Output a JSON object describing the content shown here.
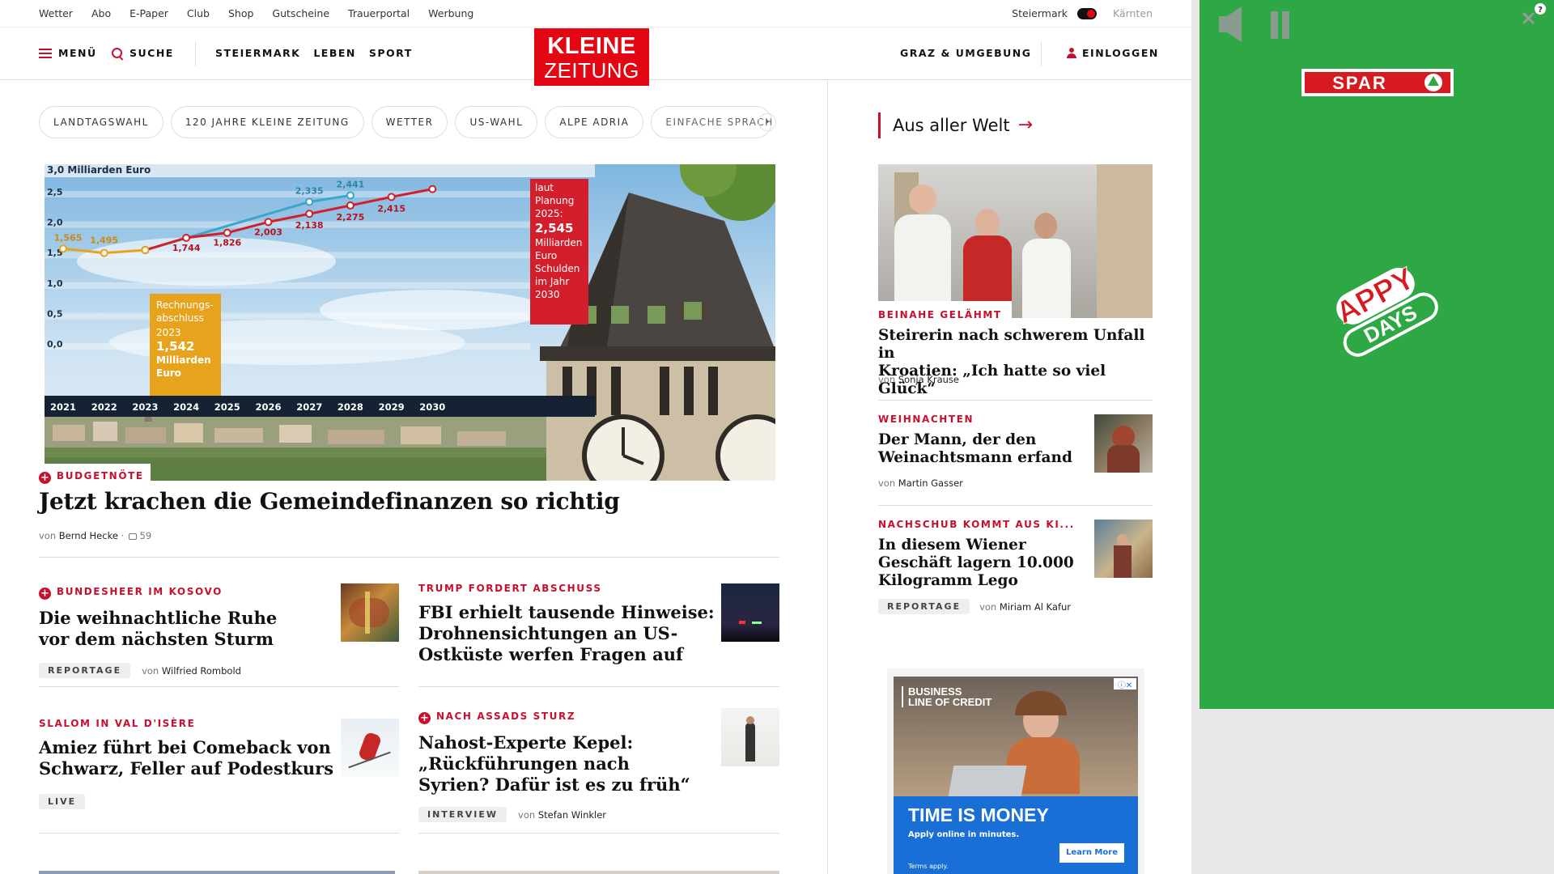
{
  "util_nav": {
    "links": [
      "Wetter",
      "Abo",
      "E-Paper",
      "Club",
      "Shop",
      "Gutscheine",
      "Trauerportal",
      "Werbung"
    ],
    "region_left": "Steiermark",
    "region_right": "Kärnten"
  },
  "header": {
    "menu": "MENÜ",
    "search": "SUCHE",
    "nav": [
      "STEIERMARK",
      "LEBEN",
      "SPORT"
    ],
    "logo_line1": "KLEINE",
    "logo_line2": "ZEITUNG",
    "region_link": "GRAZ & UMGEBUNG",
    "login": "EINLOGGEN"
  },
  "chips": [
    "LANDTAGSWAHL",
    "120 JAHRE KLEINE ZEITUNG",
    "WETTER",
    "US-WAHL",
    "ALPE ADRIA",
    "EINFACHE SPRACHE"
  ],
  "hero": {
    "chart": {
      "unit_label": "3,0 Milliarden Euro",
      "y_ticks": [
        "3,0",
        "2,5",
        "2,0",
        "1,5",
        "1,0",
        "0,5",
        "0,0"
      ],
      "x_ticks": [
        "2021",
        "2022",
        "2023",
        "2024",
        "2025",
        "2026",
        "2027",
        "2028",
        "2029",
        "2030"
      ],
      "series_blue_labels": [
        "2,335",
        "2,441"
      ],
      "series_red_labels": [
        "1,744",
        "1,826",
        "2,003",
        "2,138",
        "2,275",
        "2,415"
      ],
      "series_yellow_labels": [
        "1,565",
        "1,495"
      ],
      "box_yellow": [
        "Rechnungs-",
        "abschluss",
        "2023",
        "1,542",
        "Milliarden",
        "Euro"
      ],
      "box_red": [
        "laut",
        "Planung",
        "2025:",
        "2,545",
        "Milliarden",
        "Euro",
        "Schulden",
        "im Jahr",
        "2030"
      ]
    },
    "kicker": "BUDGETNÖTE",
    "title": "Jetzt krachen die Gemeindefinanzen so richtig",
    "by": "von",
    "author": "Bernd Hecke",
    "comments": "59"
  },
  "articles": [
    {
      "kicker": "BUNDESHEER IM KOSOVO",
      "plus": true,
      "title_lines": [
        "Die weihnachtliche Ruhe",
        "vor dem nächsten Sturm"
      ],
      "tag": "REPORTAGE",
      "by": "von",
      "author": "Wilfried Rombold"
    },
    {
      "kicker": "TRUMP FORDERT ABSCHUSS",
      "plus": false,
      "title_lines": [
        "FBI erhielt tausende Hinweise:",
        "Drohnensichtungen an US-",
        "Ostküste werfen Fragen auf"
      ]
    },
    {
      "kicker": "SLALOM IN VAL D'ISÈRE",
      "plus": false,
      "title_lines": [
        "Amiez führt bei Comeback von",
        "Schwarz, Feller auf Podestkurs"
      ],
      "tag": "LIVE"
    },
    {
      "kicker": "NACH ASSADS STURZ",
      "plus": true,
      "title_lines": [
        "Nahost-Experte Kepel:",
        "„Rückführungen nach",
        "Syrien? Dafür ist es zu früh“"
      ],
      "tag": "INTERVIEW",
      "by": "von",
      "author": "Stefan Winkler"
    }
  ],
  "sidebar": {
    "section": "Aus aller Welt",
    "lead": {
      "kicker": "BEINAHE GELÄHMT",
      "title_lines": [
        "Steirerin nach schwerem Unfall in",
        "Kroatien: „Ich hatte so viel Glück“"
      ],
      "by": "von",
      "author": "Sonja Krause"
    },
    "items": [
      {
        "kicker": "WEIHNACHTEN",
        "title_lines": [
          "Der Mann, der den",
          "Weinachtsmann erfand"
        ],
        "by": "von",
        "author": "Martin Gasser"
      },
      {
        "kicker": "NACHSCHUB KOMMT AUS KI...",
        "title_lines": [
          "In diesem Wiener",
          "Geschäft lagern 10.000",
          "Kilogramm Lego"
        ],
        "tag": "REPORTAGE",
        "by": "von",
        "author": "Miriam Al Kafur"
      }
    ]
  },
  "ad_box": {
    "line1": "BUSINESS",
    "line2": "LINE OF CREDIT",
    "headline": "TIME IS MONEY",
    "sub": "Apply online in minutes.",
    "cta": "Learn More",
    "terms": "Terms apply."
  },
  "ad_green": {
    "brand": "SPAR",
    "promo_line1": "APPY",
    "promo_line2": "DAYS"
  },
  "colors": {
    "brand_red": "#e30613",
    "kicker_red": "#c8102e",
    "ad_green": "#2ea844",
    "ad_blue": "#1a6fd6"
  }
}
